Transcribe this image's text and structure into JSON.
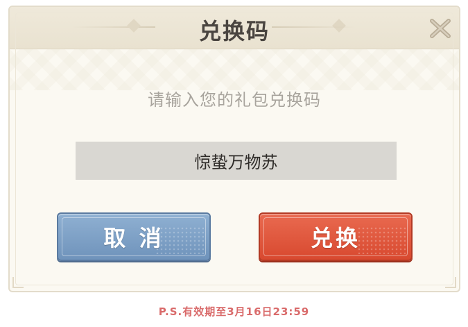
{
  "dialog": {
    "title": "兑换码",
    "prompt": "请输入您的礼包兑换码",
    "input_value": "惊蛰万物苏",
    "cancel_label": "取 消",
    "confirm_label": "兑换",
    "close_icon": "close-icon"
  },
  "footer": {
    "note": "P.S.有效期至3月16日23:59"
  },
  "colors": {
    "cancel_button": "#7a9dc5",
    "confirm_button": "#e05a3f",
    "footnote": "#d96a6a",
    "dialog_bg": "#fbf9f2"
  }
}
